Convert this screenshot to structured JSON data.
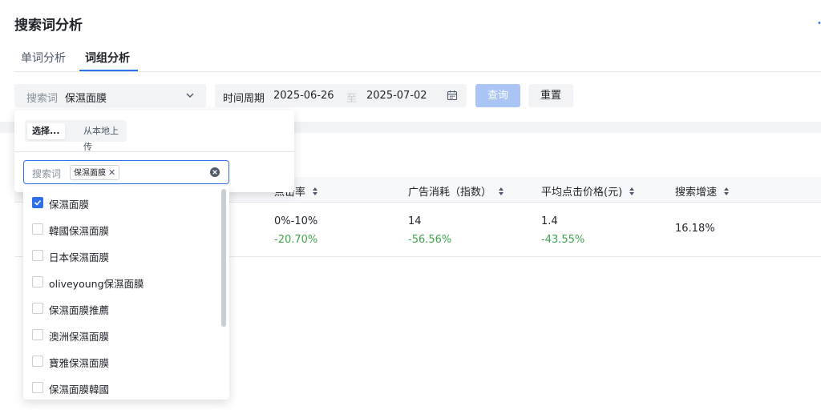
{
  "page": {
    "title": "搜索词分析"
  },
  "tabs": [
    {
      "label": "单词分析",
      "active": false
    },
    {
      "label": "词组分析",
      "active": true
    }
  ],
  "filters": {
    "keyword": {
      "label": "搜索词",
      "value": "保濕面膜"
    },
    "period": {
      "label": "时间周期",
      "start": "2025-06-26",
      "separator": "至",
      "end": "2025-07-02"
    },
    "query_button": "查询",
    "reset_button": "重置"
  },
  "table": {
    "headers": [
      {
        "label": "点击率",
        "sortable": true
      },
      {
        "label": "广告消耗（指数）",
        "sortable": true
      },
      {
        "label": "平均点击价格(元)",
        "sortable": true
      },
      {
        "label": "搜索增速",
        "sortable": true
      }
    ],
    "row": {
      "ctr": {
        "value": "0%-10%",
        "change": "-20.70%"
      },
      "ad_spend": {
        "value": "14",
        "change": "-56.56%"
      },
      "avg_cpc": {
        "value": "1.4",
        "change": "-43.55%"
      },
      "growth": {
        "value": "16.18%"
      }
    },
    "change_color": "#3fa34d"
  },
  "dropdown": {
    "segment": {
      "select": "选择...",
      "upload": "从本地上传"
    },
    "input_label": "搜索词",
    "selected_tag": "保濕面膜",
    "options": [
      {
        "label": "保濕面膜",
        "checked": true
      },
      {
        "label": "韓國保濕面膜",
        "checked": false
      },
      {
        "label": "日本保濕面膜",
        "checked": false
      },
      {
        "label": "oliveyoung保濕面膜",
        "checked": false
      },
      {
        "label": "保濕面膜推薦",
        "checked": false
      },
      {
        "label": "澳洲保濕面膜",
        "checked": false
      },
      {
        "label": "寶雅保濕面膜",
        "checked": false
      },
      {
        "label": "保濕面膜韓國",
        "checked": false
      }
    ]
  },
  "colors": {
    "accent": "#2f6fea",
    "query_disabled": "#a9c4f5"
  },
  "icons": [
    "chevron-down-icon",
    "calendar-icon",
    "sort-icon",
    "close-icon",
    "clear-circle-icon",
    "check-icon"
  ]
}
